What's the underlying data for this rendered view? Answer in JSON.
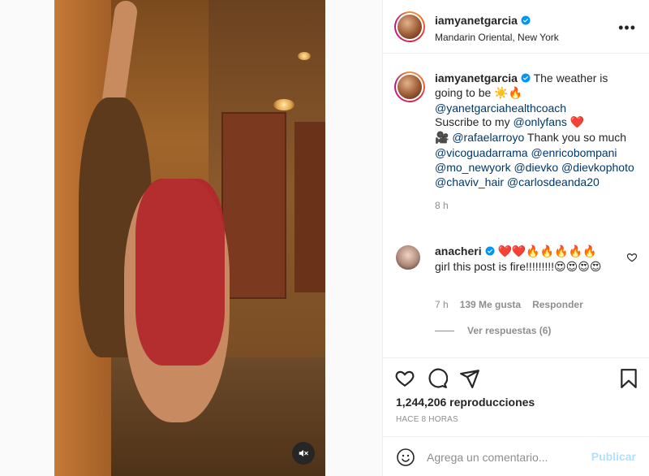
{
  "post": {
    "username": "iamyanetgarcia",
    "location": "Mandarin Oriental, New York",
    "more_icon": "more-horizontal-icon",
    "mute_icon": "speaker-muted-icon"
  },
  "caption": {
    "username": "iamyanetgarcia",
    "text_1": "The weather is going to be",
    "emoji_1": "☀️🔥",
    "mention_1": "@yanetgarciahealthcoach",
    "text_2": "Suscribe to my",
    "mention_2": "@onlyfans",
    "emoji_2": "❤️",
    "camera_emoji": "🎥",
    "mention_3": "@rafaelarroyo",
    "text_3": "Thank you so much",
    "mentions_4": "@vicoguadarrama @enricobompani @mo_newyork @dievko @dievkophoto @chaviv_hair @carlosdeanda20",
    "time": "8 h"
  },
  "comment": {
    "username": "anacheri",
    "emojis": "❤️❤️🔥🔥🔥🔥🔥",
    "text": "girl this post is fire!!!!!!!!!",
    "emojis_2": "😍😍😍😍",
    "time": "7 h",
    "likes": "139 Me gusta",
    "reply_label": "Responder",
    "view_replies": "Ver respuestas (6)"
  },
  "actions": {
    "views": "1,244,206 reproducciones",
    "posted_ago": "HACE 8 HORAS",
    "comment_placeholder": "Agrega un comentario...",
    "publish_label": "Publicar"
  },
  "colors": {
    "mention": "#00376b",
    "secondary_text": "#8e8e8e",
    "publish_disabled": "#b2dffc",
    "verified": "#0095f6"
  }
}
